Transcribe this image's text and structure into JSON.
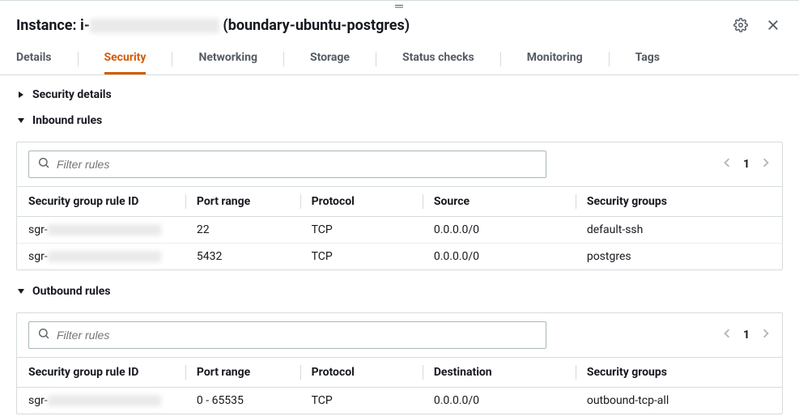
{
  "header": {
    "title_prefix": "Instance: i-",
    "title_suffix": " (boundary-ubuntu-postgres)"
  },
  "tabs": [
    {
      "label": "Details"
    },
    {
      "label": "Security"
    },
    {
      "label": "Networking"
    },
    {
      "label": "Storage"
    },
    {
      "label": "Status checks"
    },
    {
      "label": "Monitoring"
    },
    {
      "label": "Tags"
    }
  ],
  "active_tab_index": 1,
  "sections": {
    "security_details": {
      "label": "Security details",
      "expanded": false
    },
    "inbound": {
      "label": "Inbound rules",
      "expanded": true,
      "filter_placeholder": "Filter rules",
      "page": "1",
      "columns": {
        "id": "Security group rule ID",
        "port": "Port range",
        "protocol": "Protocol",
        "source": "Source",
        "groups": "Security groups"
      },
      "rows": [
        {
          "id_prefix": "sgr-",
          "port": "22",
          "protocol": "TCP",
          "source": "0.0.0.0/0",
          "groups": "default-ssh"
        },
        {
          "id_prefix": "sgr-",
          "port": "5432",
          "protocol": "TCP",
          "source": "0.0.0.0/0",
          "groups": "postgres"
        }
      ]
    },
    "outbound": {
      "label": "Outbound rules",
      "expanded": true,
      "filter_placeholder": "Filter rules",
      "page": "1",
      "columns": {
        "id": "Security group rule ID",
        "port": "Port range",
        "protocol": "Protocol",
        "destination": "Destination",
        "groups": "Security groups"
      },
      "rows": [
        {
          "id_prefix": "sgr-",
          "port": "0 - 65535",
          "protocol": "TCP",
          "destination": "0.0.0.0/0",
          "groups": "outbound-tcp-all"
        }
      ]
    }
  }
}
